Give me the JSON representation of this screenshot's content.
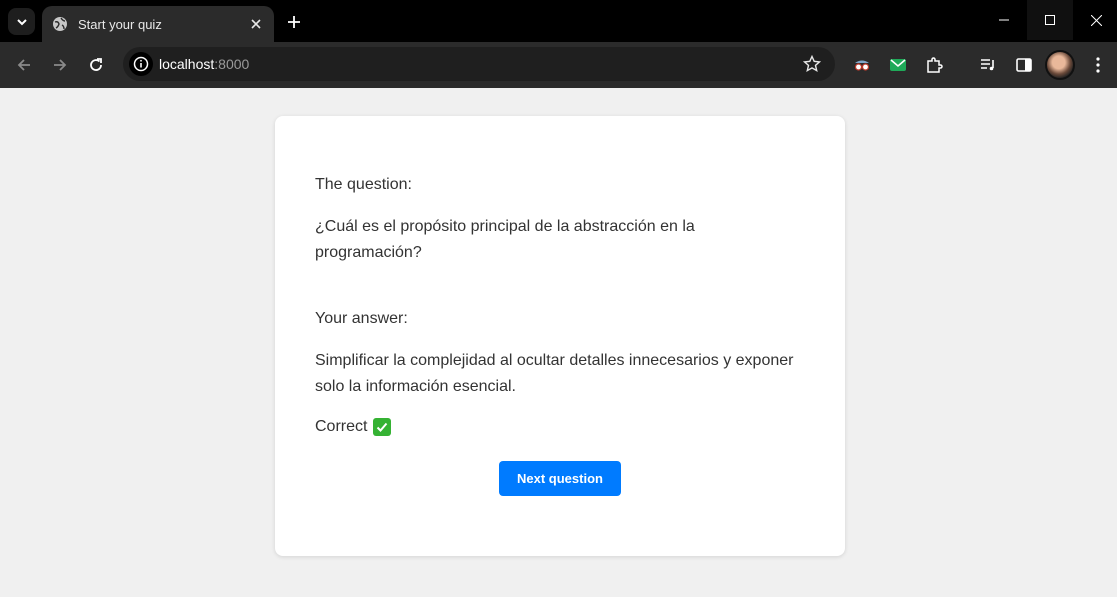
{
  "browser": {
    "tab_title": "Start your quiz",
    "url_host": "localhost",
    "url_port": ":8000"
  },
  "quiz": {
    "question_label": "The question:",
    "question_text": "¿Cuál es el propósito principal de la abstracción en la programación?",
    "answer_label": "Your answer:",
    "answer_text": "Simplificar la complejidad al ocultar detalles innecesarios y exponer solo la información esencial.",
    "result_text": "Correct",
    "next_button_label": "Next question"
  },
  "colors": {
    "accent": "#007bff",
    "correct": "#35b233",
    "page_bg": "#f0f0f0"
  }
}
